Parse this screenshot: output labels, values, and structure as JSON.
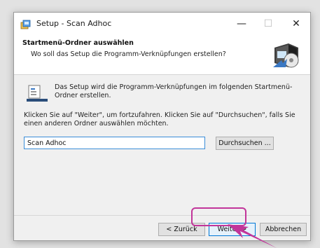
{
  "window": {
    "title": "Setup - Scan Adhoc",
    "minimize_symbol": "—",
    "maximize_symbol": "☐",
    "close_symbol": "✕"
  },
  "header": {
    "title": "Startmenü-Ordner auswählen",
    "subtitle": "Wo soll das Setup die Programm-Verknüpfungen erstellen?",
    "image_icon": "computer-install-icon"
  },
  "body": {
    "folder_icon": "startmenu-folder-icon",
    "intro": "Das Setup wird die Programm-Verknüpfungen im folgenden Startmenü-Ordner erstellen.",
    "instruction": "Klicken Sie auf \"Weiter\", um fortzufahren. Klicken Sie auf \"Durchsuchen\", falls Sie einen anderen Ordner auswählen möchten.",
    "folder_value": "Scan Adhoc",
    "browse_label": "Durchsuchen ..."
  },
  "footer": {
    "back_label": "< Zurück",
    "next_label": "Weiter >",
    "cancel_label": "Abbrechen"
  },
  "colors": {
    "highlight": "#c2359a",
    "accent": "#0078d7"
  }
}
